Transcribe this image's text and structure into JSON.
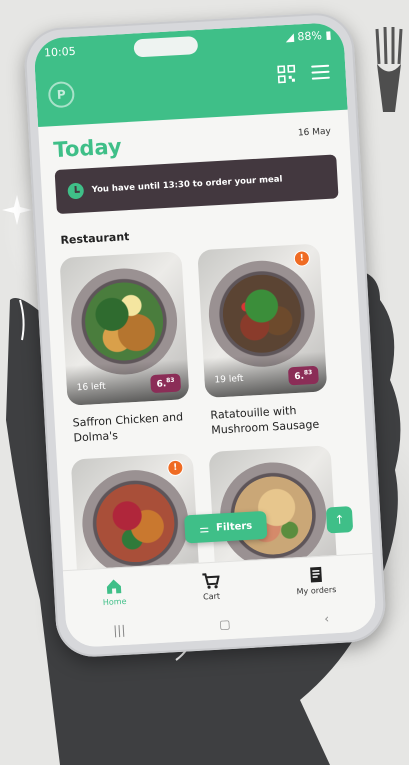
{
  "status_bar": {
    "time": "10:05",
    "battery": "88%"
  },
  "header": {
    "logo_letter": "P",
    "title": "Today",
    "date": "16 May"
  },
  "notice": {
    "text": "You have until 13:30 to order your meal"
  },
  "section_title": "Restaurant",
  "meals": [
    {
      "left": "16 left",
      "price_main": "6.",
      "price_cents": "83",
      "name": "Saffron Chicken and Dolma's",
      "warning": false
    },
    {
      "left": "19 left",
      "price_main": "6.",
      "price_cents": "83",
      "name": "Ratatouille with Mushroom Sausage",
      "warning": true
    },
    {
      "warning": true
    },
    {
      "warning": false
    }
  ],
  "filters_label": "Filters",
  "nav": {
    "home": "Home",
    "cart": "Cart",
    "orders": "My orders"
  },
  "colors": {
    "accent": "#3fbf88",
    "price": "#8b2d57",
    "alert_bg": "#43383f",
    "warning": "#ef6b23"
  },
  "icons": [
    "qr-code-icon",
    "hamburger-menu-icon",
    "clock-icon",
    "warning-icon",
    "filter-icon",
    "arrow-up-icon",
    "home-icon",
    "cart-icon",
    "orders-icon"
  ]
}
